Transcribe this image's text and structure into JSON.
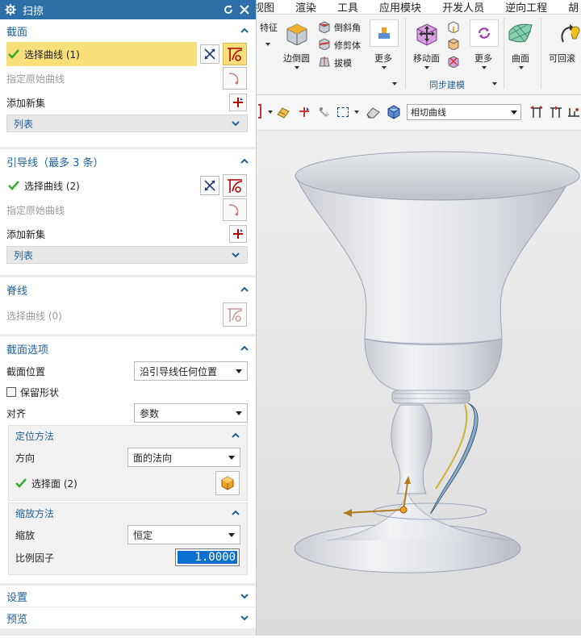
{
  "dialog": {
    "title": "扫掠",
    "section_profile": {
      "header": "截面",
      "select_curve": "选择曲线 (1)",
      "specify_origin": "指定原始曲线",
      "add_new_set": "添加新集",
      "list": "列表"
    },
    "section_guide": {
      "header": "引导线（最多 3 条）",
      "select_curve": "选择曲线 (2)",
      "specify_origin": "指定原始曲线",
      "add_new_set": "添加新集",
      "list": "列表"
    },
    "section_spine": {
      "header": "脊线",
      "select_curve": "选择曲线 (0)"
    },
    "section_options": {
      "header": "截面选项",
      "position_label": "截面位置",
      "position_value": "沿引导线任何位置",
      "keep_shape_label": "保留形状",
      "align_label": "对齐",
      "align_value": "参数",
      "orientation": {
        "header": "定位方法",
        "direction_label": "方向",
        "direction_value": "面的法向",
        "select_face": "选择面 (2)"
      },
      "scaling": {
        "header": "缩放方法",
        "scale_label": "缩放",
        "scale_value": "恒定",
        "factor_label": "比例因子",
        "factor_value": "1.0000"
      }
    },
    "settings": "设置",
    "preview": "预览"
  },
  "ribbon": {
    "menus": [
      "视图",
      "渲染",
      "工具",
      "应用模块",
      "开发人员",
      "逆向工程",
      "胡"
    ],
    "feature_label": "特征",
    "edge_blend": "边倒圆",
    "chamfer": "倒斜角",
    "trim_body": "修剪体",
    "draft": "拔模",
    "more1": "更多",
    "move_face": "移动面",
    "more2": "更多",
    "surface": "曲面",
    "undo_list": "可回滚",
    "sync_group": "同步建模"
  },
  "toolbar": {
    "curve_rule": "相切曲线"
  },
  "colors": {
    "title_bar": "#2e6fa7",
    "section_header": "#1f5f9b",
    "highlight": "#f9df7a",
    "check": "#3aa832",
    "selection": "#0b6fd0"
  }
}
